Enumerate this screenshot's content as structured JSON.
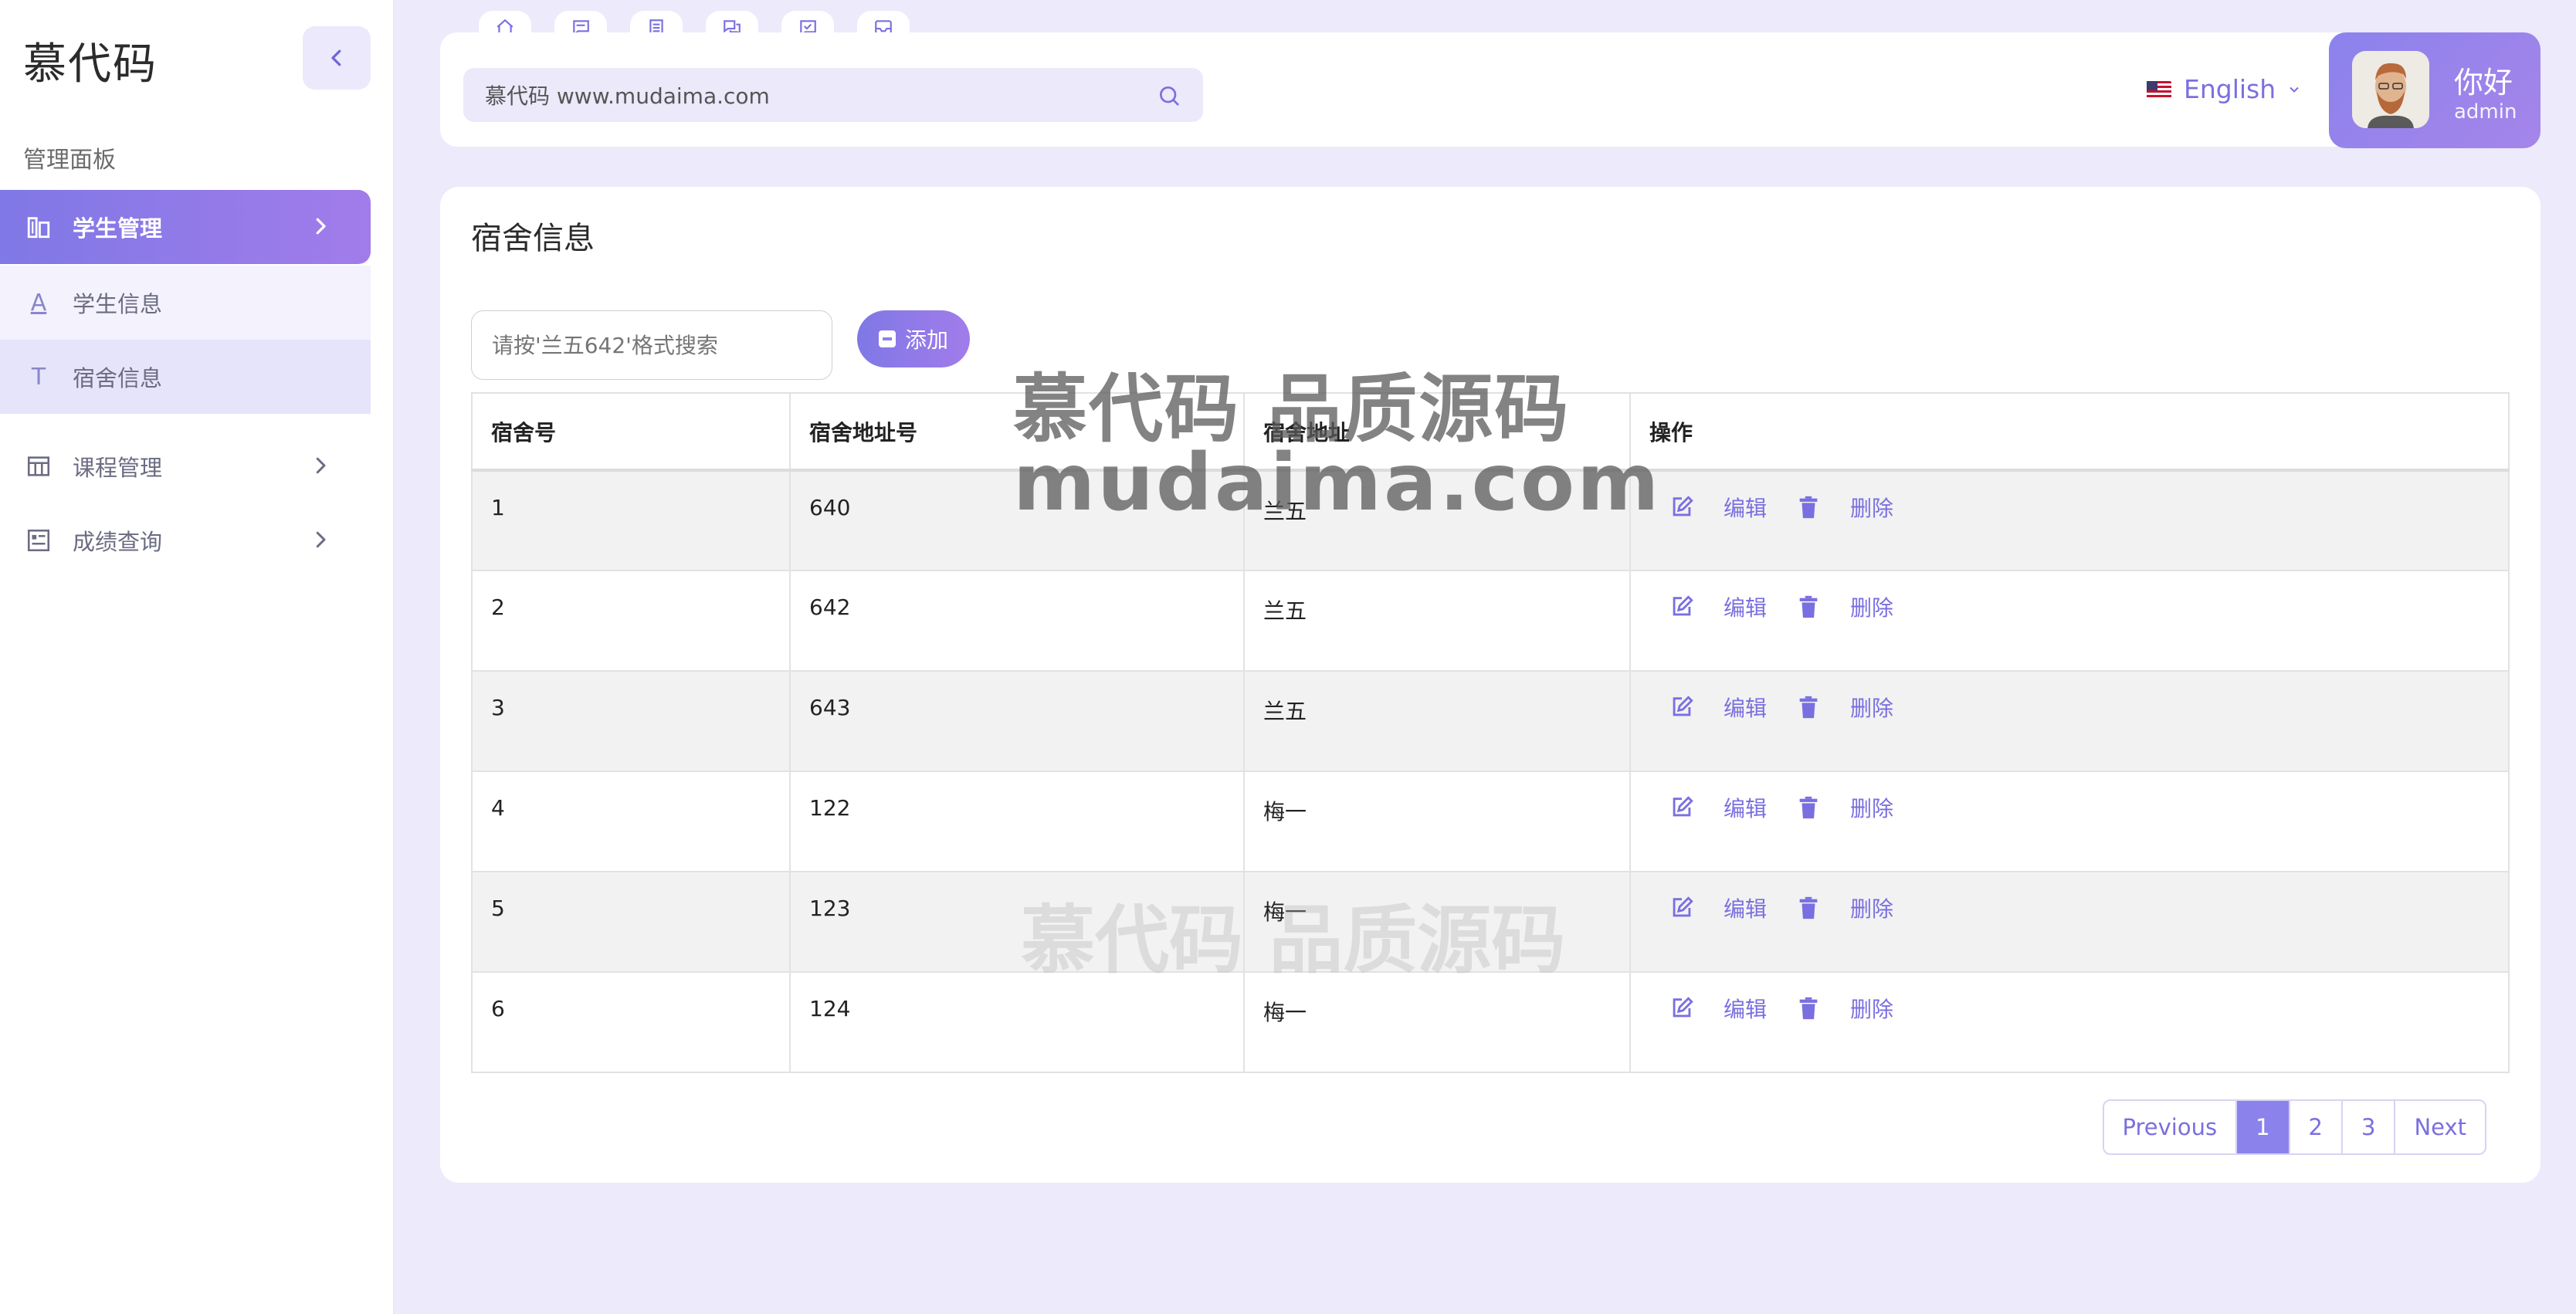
{
  "brand": "慕代码",
  "sidebar": {
    "section_label": "管理面板",
    "items": [
      {
        "label": "学生管理"
      },
      {
        "label": "学生信息",
        "glyph": "A"
      },
      {
        "label": "宿舍信息",
        "glyph": "T"
      },
      {
        "label": "课程管理"
      },
      {
        "label": "成绩查询"
      }
    ]
  },
  "header": {
    "quick_tabs": [
      "home-icon",
      "message-icon",
      "document-icon",
      "chat-icon",
      "task-icon",
      "inbox-icon"
    ],
    "search_text": "慕代码 www.mudaima.com",
    "language": "English",
    "user": {
      "greeting": "你好",
      "role": "admin"
    }
  },
  "main": {
    "title": "宿舍信息",
    "query_placeholder": "请按'兰五642'格式搜索",
    "add_label": "添加",
    "table": {
      "headers": [
        "宿舍号",
        "宿舍地址号",
        "宿舍地址",
        "操作"
      ],
      "rows": [
        [
          "1",
          "640",
          "兰五"
        ],
        [
          "2",
          "642",
          "兰五"
        ],
        [
          "3",
          "643",
          "兰五"
        ],
        [
          "4",
          "122",
          "梅一"
        ],
        [
          "5",
          "123",
          "梅一"
        ],
        [
          "6",
          "124",
          "梅一"
        ]
      ],
      "edit_label": "编辑",
      "delete_label": "删除"
    },
    "pagination": {
      "prev": "Previous",
      "pages": [
        "1",
        "2",
        "3"
      ],
      "current": "1",
      "next": "Next"
    }
  },
  "watermark": {
    "line1": "慕代码 品质源码",
    "line2": "mudaima.com"
  },
  "colors": {
    "accent": "#8c82ec",
    "accent_text": "#7a6fe0",
    "background": "#eceafb"
  }
}
